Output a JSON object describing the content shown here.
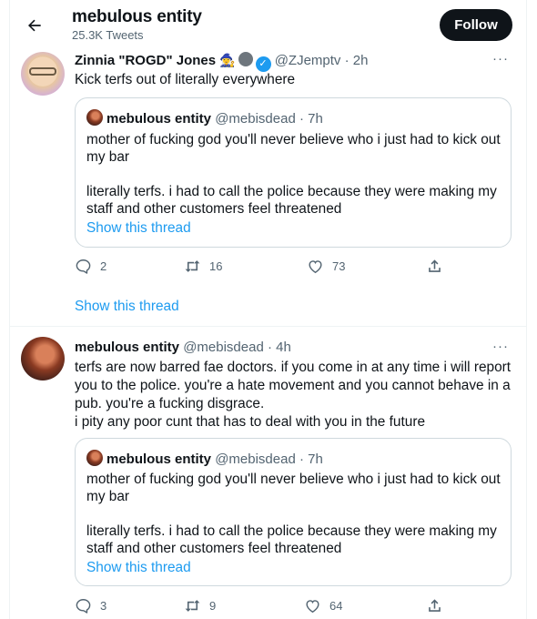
{
  "header": {
    "title": "mebulous entity",
    "subtitle": "25.3K Tweets",
    "follow_label": "Follow"
  },
  "tweet1": {
    "name": "Zinnia \"ROGD\" Jones",
    "emoji": "🧙‍♀️",
    "handle": "@ZJemptv",
    "time": "· 2h",
    "more": "···",
    "text": "Kick terfs out of literally everywhere",
    "quote": {
      "name": "mebulous entity",
      "handle": "@mebisdead",
      "time": "· 7h",
      "line1": "mother of fucking god you'll never believe who i just had to kick out",
      "line2": "my bar",
      "line3": "literally terfs. i had to call the police because they were making my",
      "line4": "staff and other customers feel threatened",
      "show_thread": "Show this thread"
    },
    "replies": "2",
    "retweets": "16",
    "likes": "73"
  },
  "show_thread_link": "Show this thread",
  "tweet2": {
    "name": "mebulous entity",
    "handle": "@mebisdead",
    "time": "· 4h",
    "more": "···",
    "line1": "terfs are now barred fae doctors. if you come in at any time i will report",
    "line2": "you to the police. you're a hate movement and you cannot behave in a",
    "line3": "pub. you're a fucking disgrace.",
    "line4": "i pity any poor cunt that has to deal with you in the future",
    "quote": {
      "name": "mebulous entity",
      "handle": "@mebisdead",
      "time": "· 7h",
      "line1": "mother of fucking god you'll never believe who i just had to kick out",
      "line2": "my bar",
      "line3": "literally terfs. i had to call the police because they were making my",
      "line4": "staff and other customers feel threatened",
      "show_thread": "Show this thread"
    },
    "replies": "3",
    "retweets": "9",
    "likes": "64"
  },
  "icons": [
    "back-arrow-icon",
    "verified-badge-icon",
    "more-icon",
    "reply-icon",
    "retweet-icon",
    "like-icon",
    "share-icon"
  ],
  "colors": {
    "accent": "#1d9bf0",
    "text": "#0f1419",
    "muted": "#536471",
    "border": "#cfd9de"
  }
}
